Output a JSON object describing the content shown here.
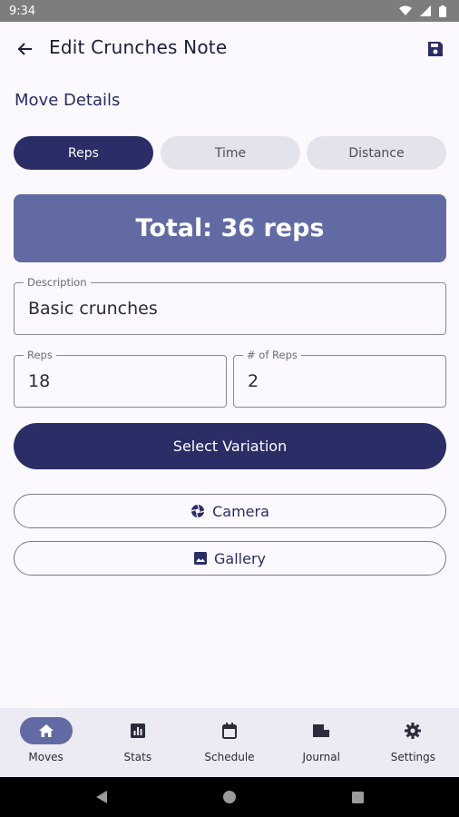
{
  "status_bar": {
    "time": "9:34"
  },
  "app_bar": {
    "title": "Edit Crunches Note"
  },
  "section": {
    "title": "Move Details"
  },
  "segments": [
    {
      "label": "Reps",
      "active": true
    },
    {
      "label": "Time",
      "active": false
    },
    {
      "label": "Distance",
      "active": false
    }
  ],
  "total": {
    "text": "Total: 36 reps"
  },
  "fields": {
    "description": {
      "label": "Description",
      "value": "Basic crunches"
    },
    "reps": {
      "label": "Reps",
      "value": "18"
    },
    "num_reps": {
      "label": "# of Reps",
      "value": "2"
    }
  },
  "buttons": {
    "select_variation": "Select Variation",
    "camera": "Camera",
    "gallery": "Gallery"
  },
  "bottom_nav": [
    {
      "label": "Moves",
      "icon": "home-icon",
      "active": true
    },
    {
      "label": "Stats",
      "icon": "stats-icon",
      "active": false
    },
    {
      "label": "Schedule",
      "icon": "calendar-icon",
      "active": false
    },
    {
      "label": "Journal",
      "icon": "journal-icon",
      "active": false
    },
    {
      "label": "Settings",
      "icon": "gear-icon",
      "active": false
    }
  ],
  "colors": {
    "primary": "#2a2d66",
    "total_card": "#626aa3",
    "background": "#fbf8fe",
    "nav_background": "#eceaf3"
  }
}
